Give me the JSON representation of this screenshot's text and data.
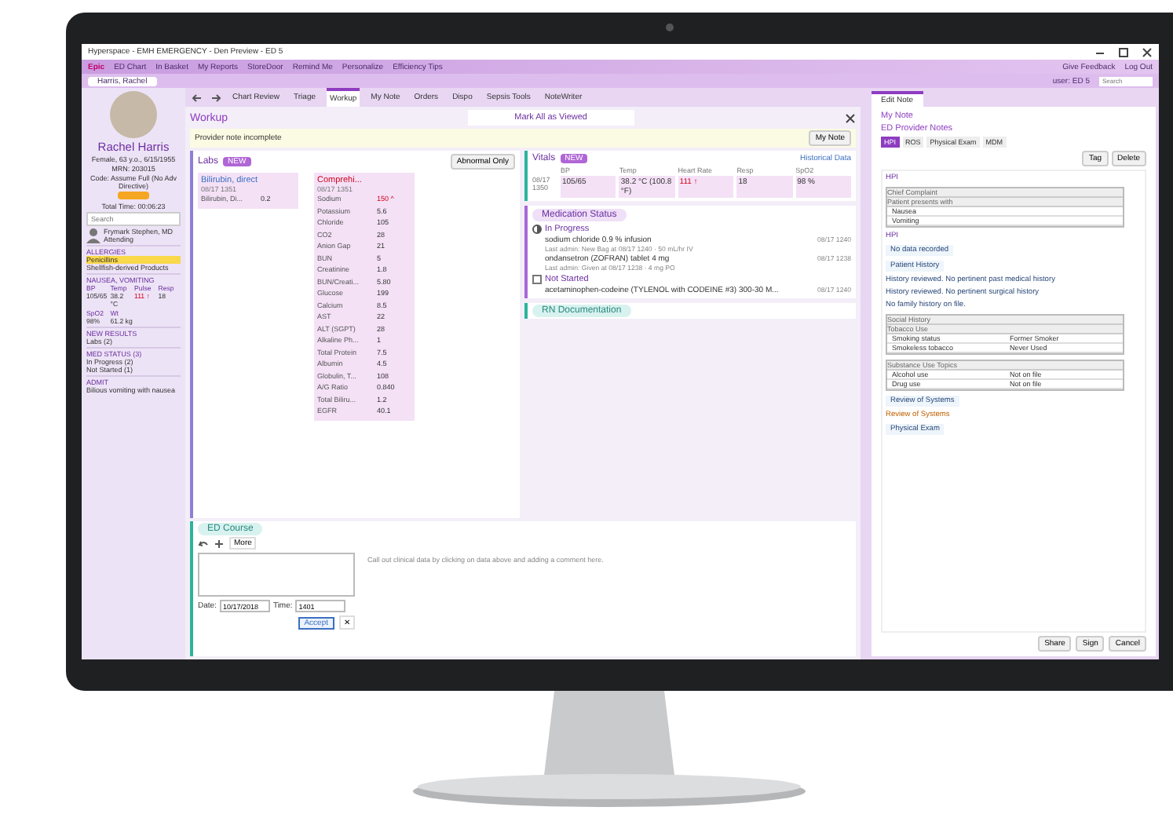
{
  "window": {
    "title": "Hyperspace - EMH EMERGENCY - Den Preview - ED 5"
  },
  "menu_bar": {
    "items": [
      "Epic",
      "ED Chart",
      "In Basket",
      "My Reports",
      "StoreDoor",
      "Remind Me",
      "Personalize",
      "Efficiency Tips"
    ],
    "right_items": [
      "Give Feedback",
      "Log Out"
    ]
  },
  "patient_tabs": [
    {
      "label": "Harris, Rachel",
      "selected": true
    }
  ],
  "user": {
    "label": "user: ED 5",
    "search_placeholder": "Search"
  },
  "sidebar": {
    "name": "Rachel Harris",
    "demographics": "Female, 63 y.o., 6/15/1955",
    "mrn": "MRN: 203015",
    "code": "Code: Assume Full (No Adv Directive)",
    "total_time": "Total Time: 00:06:23",
    "search_placeholder": "Search",
    "provider": {
      "name": "Frymark Stephen, MD",
      "role": "Attending"
    },
    "sections": [
      {
        "header": "ALLERGIES",
        "items": [
          {
            "text": "Penicillins",
            "highlighted": true
          },
          {
            "text": "Shellfish-derived Products",
            "highlighted": false
          }
        ]
      },
      {
        "header": "NAUSEA, VOMITING",
        "vitals": [
          {
            "label": "BP",
            "value": "105/65",
            "abnormal": false
          },
          {
            "label": "Temp",
            "value": "38.2 °C",
            "abnormal": false
          },
          {
            "label": "Pulse",
            "value": "111 ↑",
            "abnormal": true
          },
          {
            "label": "Resp",
            "value": "18",
            "abnormal": false
          },
          {
            "label": "SpO2",
            "value": "98%",
            "abnormal": false
          },
          {
            "label": "Wt",
            "value": "61.2 kg",
            "abnormal": false
          }
        ]
      },
      {
        "header": "NEW RESULTS",
        "items": [
          {
            "text": "Labs (2)",
            "highlighted": false
          }
        ]
      },
      {
        "header": "MED STATUS (3)",
        "items": [
          {
            "text": "In Progress (2)",
            "highlighted": false
          },
          {
            "text": "Not Started (1)",
            "highlighted": false
          }
        ]
      },
      {
        "header": "ADMIT",
        "items": [
          {
            "text": "Bilious vomiting with nausea",
            "highlighted": false
          }
        ]
      }
    ]
  },
  "activity_tabs": [
    {
      "label": "Chart Review",
      "selected": false
    },
    {
      "label": "Triage",
      "selected": false
    },
    {
      "label": "Workup",
      "selected": true
    },
    {
      "label": "My Note",
      "selected": false
    },
    {
      "label": "Orders",
      "selected": false
    },
    {
      "label": "Dispo",
      "selected": false
    },
    {
      "label": "Sepsis Tools",
      "selected": false
    },
    {
      "label": "NoteWriter",
      "selected": false
    }
  ],
  "workup": {
    "title": "Workup",
    "mark_all_button": "Mark All as Viewed",
    "banner": "Provider note incomplete",
    "my_note_button": "My Note",
    "labs": {
      "title": "Labs",
      "badge": "NEW",
      "filter_button": "Abnormal Only",
      "panels": [
        {
          "title": "Bilirubin, direct",
          "abnormal": false,
          "time": "08/17 1351",
          "rows": [
            {
              "name": "Bilirubin, Di...",
              "value": "0.2",
              "abnormal": false
            }
          ]
        },
        {
          "title": "Comprehi...",
          "abnormal": true,
          "time": "08/17 1351",
          "rows": [
            {
              "name": "Sodium",
              "value": "150 ^",
              "abnormal": true
            },
            {
              "name": "Potassium",
              "value": "5.6",
              "abnormal": false
            },
            {
              "name": "Chloride",
              "value": "105",
              "abnormal": false
            },
            {
              "name": "CO2",
              "value": "28",
              "abnormal": false
            },
            {
              "name": "Anion Gap",
              "value": "21",
              "abnormal": false
            },
            {
              "name": "BUN",
              "value": "5",
              "abnormal": false
            },
            {
              "name": "Creatinine",
              "value": "1.8",
              "abnormal": false
            },
            {
              "name": "BUN/Creati...",
              "value": "5.80",
              "abnormal": false
            },
            {
              "name": "Glucose",
              "value": "199",
              "abnormal": false
            },
            {
              "name": "Calcium",
              "value": "8.5",
              "abnormal": false
            },
            {
              "name": "AST",
              "value": "22",
              "abnormal": false
            },
            {
              "name": "ALT (SGPT)",
              "value": "28",
              "abnormal": false
            },
            {
              "name": "Alkaline Ph...",
              "value": "1",
              "abnormal": false
            },
            {
              "name": "Total Protein",
              "value": "7.5",
              "abnormal": false
            },
            {
              "name": "Albumin",
              "value": "4.5",
              "abnormal": false
            },
            {
              "name": "Globulin, T...",
              "value": "108",
              "abnormal": false
            },
            {
              "name": "A/G Ratio",
              "value": "0.840",
              "abnormal": false
            },
            {
              "name": "Total Biliru...",
              "value": "1.2",
              "abnormal": false
            },
            {
              "name": "EGFR",
              "value": "40.1",
              "abnormal": false
            }
          ]
        }
      ]
    },
    "vitals": {
      "title": "Vitals",
      "badge": "NEW",
      "link": "Historical Data",
      "columns": [
        "BP",
        "Temp",
        "Heart Rate",
        "Resp",
        "SpO2"
      ],
      "rows": [
        {
          "time": "08/17 1350",
          "cells": [
            {
              "value": "105/65",
              "abnormal": false
            },
            {
              "value": "38.2 °C (100.8 °F)",
              "abnormal": false
            },
            {
              "value": "111 ↑",
              "abnormal": true
            },
            {
              "value": "18",
              "abnormal": false
            },
            {
              "value": "98 %",
              "abnormal": false
            }
          ]
        }
      ]
    },
    "medications": {
      "title": "Medication Status",
      "groups": [
        {
          "label": "In Progress",
          "kind": "progress",
          "items": [
            {
              "name": "sodium chloride 0.9 % infusion",
              "time": "08/17 1240",
              "detail": "Last admin: New Bag at 08/17 1240 · 50 mL/hr IV"
            },
            {
              "name": "ondansetron (ZOFRAN) tablet 4 mg",
              "time": "08/17 1238",
              "detail": "Last admin: Given at 08/17 1238 · 4 mg PO"
            }
          ]
        },
        {
          "label": "Not Started",
          "kind": "not_started",
          "items": [
            {
              "name": "acetaminophen-codeine (TYLENOL with CODEINE #3) 300-30 M...",
              "time": "08/17 1240"
            }
          ]
        }
      ]
    },
    "rn_documentation": {
      "title": "RN Documentation"
    },
    "ed_course": {
      "title": "ED Course",
      "more_button": "More",
      "hint": "Call out clinical data by clicking on data above and adding a comment here.",
      "date_label": "Date:",
      "date": "10/17/2018",
      "time_label": "Time:",
      "time": "1401",
      "accept_button": "Accept",
      "cancel_button": "✕"
    }
  },
  "note_panel": {
    "tab": "Edit Note",
    "title": "My Note",
    "subtitle": "ED Provider Notes",
    "section_tabs": [
      {
        "label": "HPI",
        "selected": true
      },
      {
        "label": "ROS",
        "selected": false
      },
      {
        "label": "Physical Exam",
        "selected": false
      },
      {
        "label": "MDM",
        "selected": false
      }
    ],
    "tag_button": "Tag",
    "delete_button": "Delete",
    "body": [
      {
        "kind": "heading",
        "text": "HPI"
      },
      {
        "kind": "table",
        "title": "Chief Complaint",
        "subtitle": "Patient presents with",
        "rows": [
          [
            "Nausea"
          ],
          [
            "Vomiting"
          ]
        ]
      },
      {
        "kind": "heading",
        "text": "HPI"
      },
      {
        "kind": "chip",
        "text": "No data recorded"
      },
      {
        "kind": "chip",
        "text": "Patient History"
      },
      {
        "kind": "line",
        "text": "History reviewed. No pertinent past medical history"
      },
      {
        "kind": "line",
        "text": "History reviewed. No pertinent surgical history"
      },
      {
        "kind": "line",
        "text": "No family history on file."
      },
      {
        "kind": "table",
        "title": "Social History",
        "subtitle": "Tobacco Use",
        "rows": [
          [
            "Smoking status",
            "Former Smoker"
          ],
          [
            "Smokeless tobacco",
            "Never Used"
          ]
        ]
      },
      {
        "kind": "table",
        "subtitle": "Substance Use Topics",
        "rows": [
          [
            "Alcohol use",
            "Not on file"
          ],
          [
            "Drug use",
            "Not on file"
          ]
        ]
      },
      {
        "kind": "chip",
        "text": "Review of Systems"
      },
      {
        "kind": "orange",
        "text": "Review of Systems"
      },
      {
        "kind": "chip",
        "text": "Physical Exam"
      }
    ],
    "footer_buttons": [
      "Share",
      "Sign",
      "Cancel"
    ]
  }
}
